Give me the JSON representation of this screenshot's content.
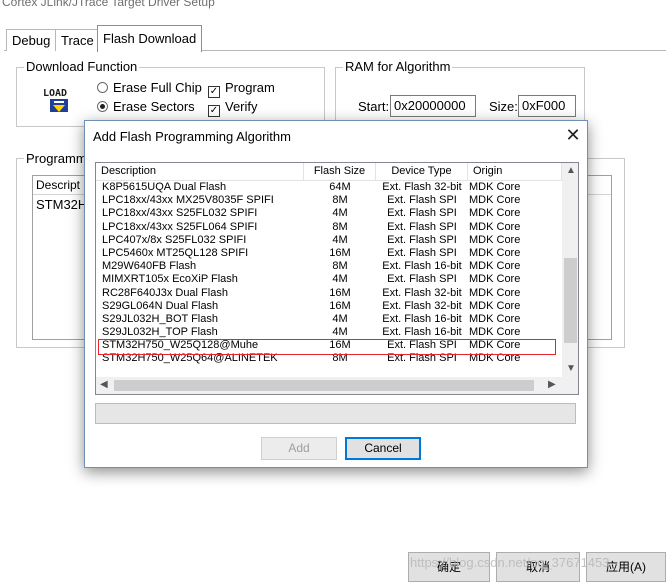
{
  "window": {
    "title": "Cortex JLink/JTrace Target Driver Setup"
  },
  "tabs": [
    {
      "label": "Debug"
    },
    {
      "label": "Trace"
    },
    {
      "label": "Flash Download"
    }
  ],
  "download_function": {
    "group_label": "Download Function",
    "load_icon": "load-icon",
    "options": {
      "erase_full_chip": "Erase Full Chip",
      "erase_sectors": "Erase Sectors",
      "program": "Program",
      "verify": "Verify"
    },
    "selected": "Erase Sectors",
    "checked": [
      "Program",
      "Verify"
    ]
  },
  "ram_for_algorithm": {
    "group_label": "RAM for Algorithm",
    "start_label": "Start:",
    "start_value": "0x20000000",
    "size_label": "Size:",
    "size_value": "0xF000"
  },
  "programming_algorithm": {
    "group_label": "Programm",
    "column_desc": "Descript",
    "row": "STM32H"
  },
  "bottom_buttons": {
    "ok": "确定",
    "cancel": "取消",
    "apply": "应用(A)"
  },
  "watermark": "https://blog.csdn.net/qq_37671453",
  "dialog": {
    "title": "Add Flash Programming Algorithm",
    "close_icon": "close-icon",
    "columns": [
      "Description",
      "Flash Size",
      "Device Type",
      "Origin"
    ],
    "rows": [
      {
        "desc": "K8P5615UQA Dual Flash",
        "size": "64M",
        "type": "Ext. Flash 32-bit",
        "origin": "MDK Core"
      },
      {
        "desc": "LPC18xx/43xx MX25V8035F SPIFI",
        "size": "8M",
        "type": "Ext. Flash SPI",
        "origin": "MDK Core"
      },
      {
        "desc": "LPC18xx/43xx S25FL032 SPIFI",
        "size": "4M",
        "type": "Ext. Flash SPI",
        "origin": "MDK Core"
      },
      {
        "desc": "LPC18xx/43xx S25FL064 SPIFI",
        "size": "8M",
        "type": "Ext. Flash SPI",
        "origin": "MDK Core"
      },
      {
        "desc": "LPC407x/8x S25FL032 SPIFI",
        "size": "4M",
        "type": "Ext. Flash SPI",
        "origin": "MDK Core"
      },
      {
        "desc": "LPC5460x MT25QL128 SPIFI",
        "size": "16M",
        "type": "Ext. Flash SPI",
        "origin": "MDK Core"
      },
      {
        "desc": "M29W640FB Flash",
        "size": "8M",
        "type": "Ext. Flash 16-bit",
        "origin": "MDK Core"
      },
      {
        "desc": "MIMXRT105x EcoXiP Flash",
        "size": "4M",
        "type": "Ext. Flash SPI",
        "origin": "MDK Core"
      },
      {
        "desc": "RC28F640J3x Dual Flash",
        "size": "16M",
        "type": "Ext. Flash 32-bit",
        "origin": "MDK Core"
      },
      {
        "desc": "S29GL064N Dual Flash",
        "size": "16M",
        "type": "Ext. Flash 32-bit",
        "origin": "MDK Core"
      },
      {
        "desc": "S29JL032H_BOT Flash",
        "size": "4M",
        "type": "Ext. Flash 16-bit",
        "origin": "MDK Core"
      },
      {
        "desc": "S29JL032H_TOP Flash",
        "size": "4M",
        "type": "Ext. Flash 16-bit",
        "origin": "MDK Core"
      },
      {
        "desc": "STM32H750_W25Q128@Muhe",
        "size": "16M",
        "type": "Ext. Flash SPI",
        "origin": "MDK Core"
      },
      {
        "desc": "STM32H750_W25Q64@ALINETEK",
        "size": "8M",
        "type": "Ext. Flash SPI",
        "origin": "MDK Core"
      }
    ],
    "highlighted_row": "STM32H750_W25Q128@Muhe",
    "highlight_color": "#e8242a",
    "add_button": "Add",
    "cancel_button": "Cancel"
  }
}
